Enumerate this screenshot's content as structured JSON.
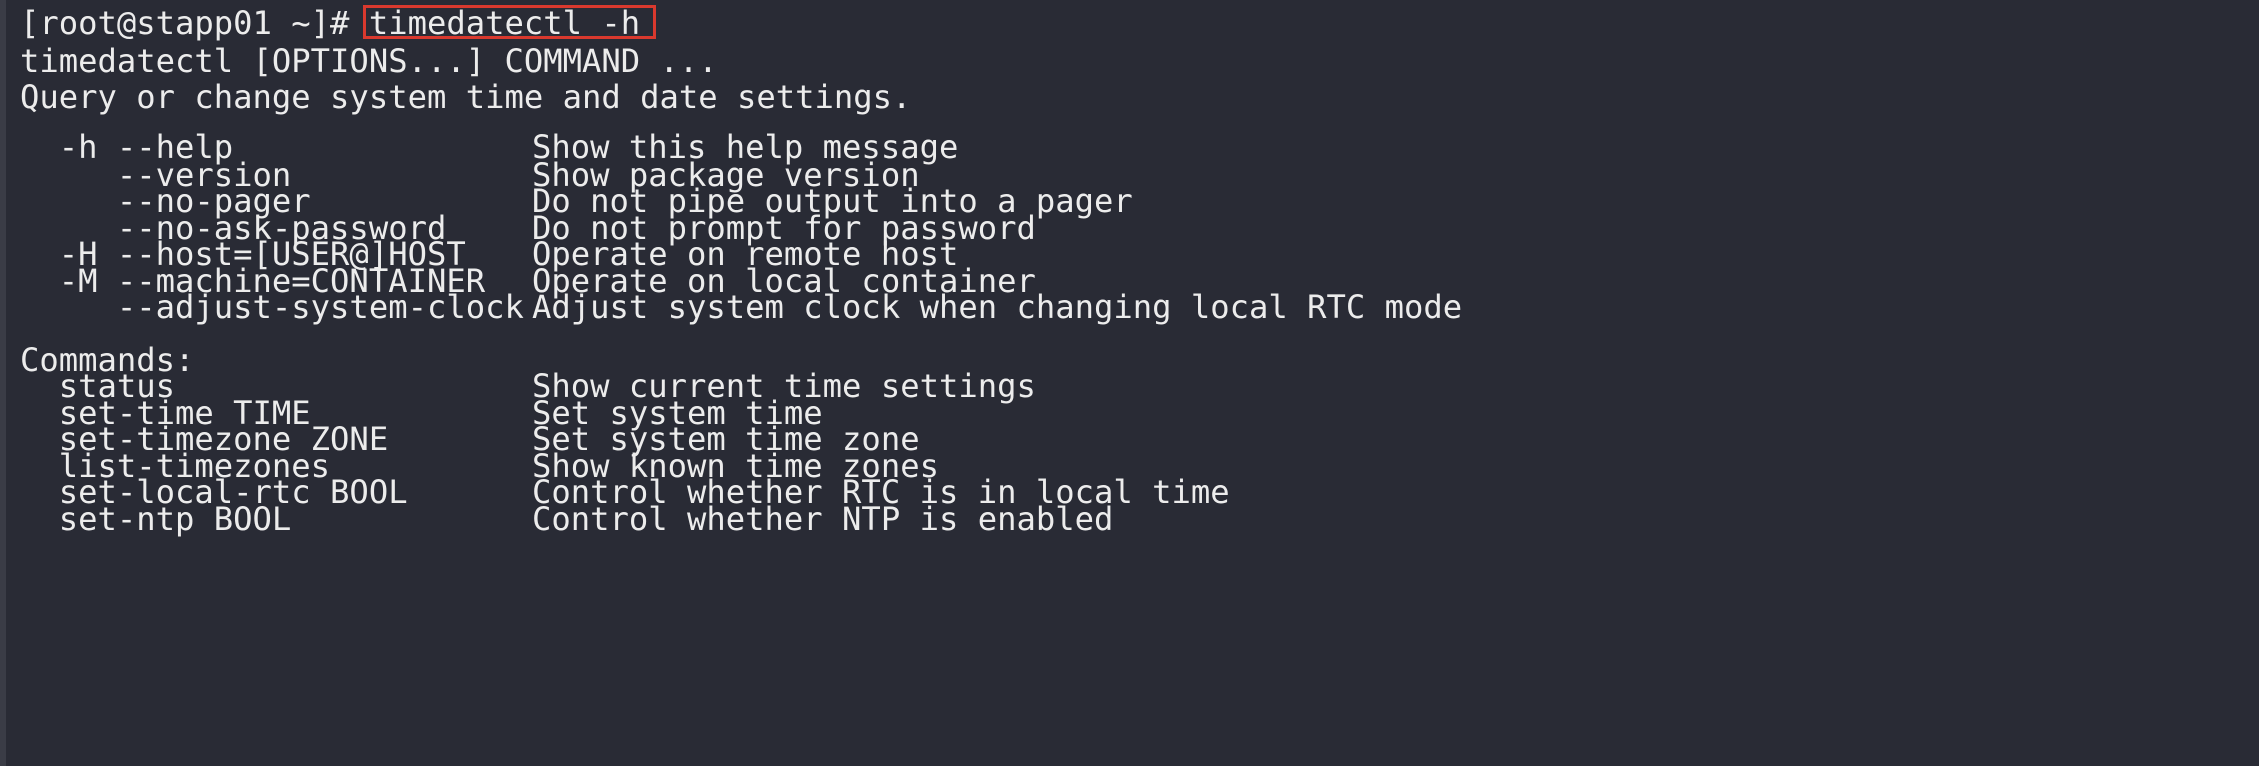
{
  "prompt": {
    "text": "[root@stapp01 ~]# ",
    "command": "timedatectl -h"
  },
  "usage": "timedatectl [OPTIONS...] COMMAND ...",
  "description": "Query or change system time and date settings.",
  "options": [
    {
      "flag": "  -h --help",
      "desc": "Show this help message"
    },
    {
      "flag": "     --version",
      "desc": "Show package version"
    },
    {
      "flag": "     --no-pager",
      "desc": "Do not pipe output into a pager"
    },
    {
      "flag": "     --no-ask-password",
      "desc": "Do not prompt for password"
    },
    {
      "flag": "  -H --host=[USER@]HOST",
      "desc": "Operate on remote host"
    },
    {
      "flag": "  -M --machine=CONTAINER",
      "desc": "Operate on local container"
    },
    {
      "flag": "     --adjust-system-clock",
      "desc": "Adjust system clock when changing local RTC mode"
    }
  ],
  "commands_header": "Commands:",
  "commands": [
    {
      "name": "  status",
      "desc": "Show current time settings"
    },
    {
      "name": "  set-time TIME",
      "desc": "Set system time"
    },
    {
      "name": "  set-timezone ZONE",
      "desc": "Set system time zone"
    },
    {
      "name": "  list-timezones",
      "desc": "Show known time zones"
    },
    {
      "name": "  set-local-rtc BOOL",
      "desc": "Control whether RTC is in local time"
    },
    {
      "name": "  set-ntp BOOL",
      "desc": "Control whether NTP is enabled"
    }
  ],
  "colors": {
    "background": "#292b35",
    "text": "#ececec",
    "highlight_box": "#d9392e"
  }
}
